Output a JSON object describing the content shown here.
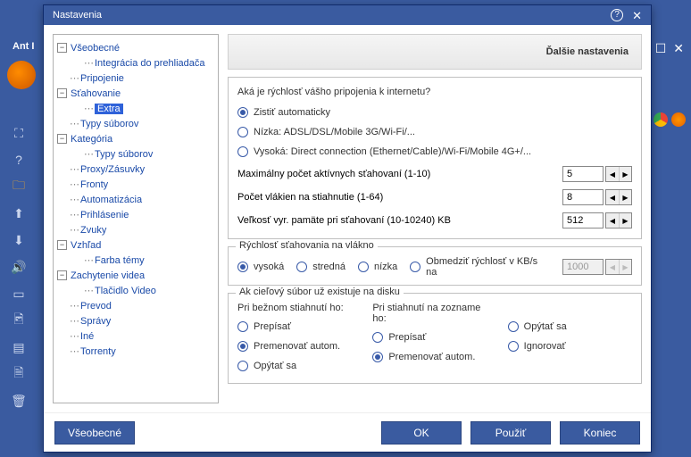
{
  "bg": {
    "title": "Ant I",
    "win_min": "—",
    "win_max": "☐",
    "win_close": "✕"
  },
  "dialog": {
    "title": "Nastavenia",
    "help_icon": "?",
    "close_icon": "✕",
    "header": "Ďalšie nastavenia"
  },
  "tree": {
    "vseobecne": "Všeobecné",
    "integracia": "Integrácia do prehliadača",
    "pripojenie": "Pripojenie",
    "stahovanie": "Sťahovanie",
    "extra": "Extra",
    "typy_suborov1": "Typy súborov",
    "kategoria": "Kategória",
    "typy_suborov2": "Typy súborov",
    "proxy": "Proxy/Zásuvky",
    "fronty": "Fronty",
    "automatizacia": "Automatizácia",
    "prihlasenie": "Prihlásenie",
    "zvuky": "Zvuky",
    "vzhlad": "Vzhľad",
    "farba_temy": "Farba témy",
    "zachytenie": "Zachytenie videa",
    "tlacidlo_video": "Tlačidlo Video",
    "prevod": "Prevod",
    "spravy": "Správy",
    "ine": "Iné",
    "torrenty": "Torrenty"
  },
  "g_speed": {
    "question": "Aká je rýchlosť vášho pripojenia k internetu?",
    "opt_auto": "Zistiť automaticky",
    "opt_low": "Nízka: ADSL/DSL/Mobile 3G/Wi-Fi/...",
    "opt_high": "Vysoká: Direct connection (Ethernet/Cable)/Wi-Fi/Mobile 4G+/...",
    "max_active": "Maximálny počet aktívnych sťahovaní (1-10)",
    "max_active_val": "5",
    "threads": "Počet vlákien na stiahnutie (1-64)",
    "threads_val": "8",
    "buffer": "Veľkosť vyr. pamäte pri sťahovaní (10-10240) KB",
    "buffer_val": "512"
  },
  "g_thread": {
    "title": "Rýchlosť sťahovania na vlákno",
    "opt_high": "vysoká",
    "opt_mid": "stredná",
    "opt_low": "nízka",
    "opt_limit": "Obmedziť rýchlosť v KB/s na",
    "limit_val": "1000"
  },
  "g_exists": {
    "title": "Ak cieľový súbor už existuje na disku",
    "col1": "Pri bežnom stiahnutí ho:",
    "col2": "Pri stiahnutí na zozname ho:",
    "prepisat": "Prepísať",
    "premenovat": "Premenovať autom.",
    "opytat": "Opýtať sa",
    "ignorovat": "Ignorovať"
  },
  "buttons": {
    "vseobecne": "Všeobecné",
    "ok": "OK",
    "pouzit": "Použiť",
    "koniec": "Koniec"
  }
}
